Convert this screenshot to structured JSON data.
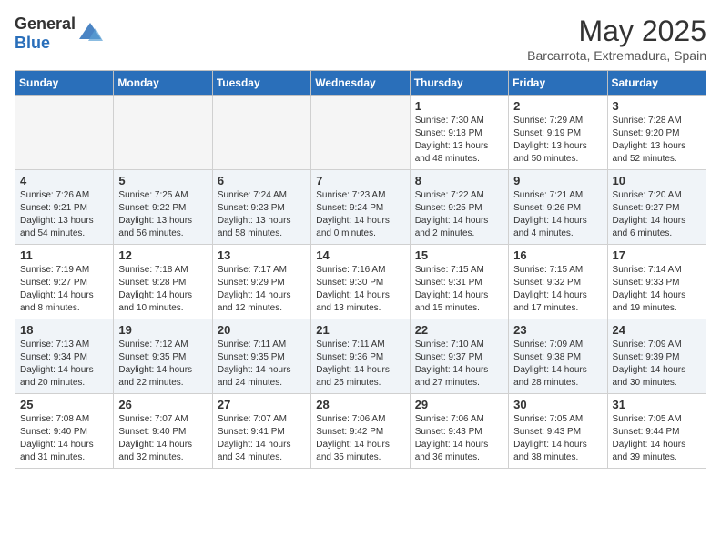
{
  "logo": {
    "text_general": "General",
    "text_blue": "Blue",
    "icon_alt": "GeneralBlue logo"
  },
  "title": {
    "month": "May 2025",
    "location": "Barcarrota, Extremadura, Spain"
  },
  "weekdays": [
    "Sunday",
    "Monday",
    "Tuesday",
    "Wednesday",
    "Thursday",
    "Friday",
    "Saturday"
  ],
  "weeks": [
    [
      {
        "day": "",
        "info": "",
        "empty": true
      },
      {
        "day": "",
        "info": "",
        "empty": true
      },
      {
        "day": "",
        "info": "",
        "empty": true
      },
      {
        "day": "",
        "info": "",
        "empty": true
      },
      {
        "day": "1",
        "info": "Sunrise: 7:30 AM\nSunset: 9:18 PM\nDaylight: 13 hours\nand 48 minutes."
      },
      {
        "day": "2",
        "info": "Sunrise: 7:29 AM\nSunset: 9:19 PM\nDaylight: 13 hours\nand 50 minutes."
      },
      {
        "day": "3",
        "info": "Sunrise: 7:28 AM\nSunset: 9:20 PM\nDaylight: 13 hours\nand 52 minutes."
      }
    ],
    [
      {
        "day": "4",
        "info": "Sunrise: 7:26 AM\nSunset: 9:21 PM\nDaylight: 13 hours\nand 54 minutes."
      },
      {
        "day": "5",
        "info": "Sunrise: 7:25 AM\nSunset: 9:22 PM\nDaylight: 13 hours\nand 56 minutes."
      },
      {
        "day": "6",
        "info": "Sunrise: 7:24 AM\nSunset: 9:23 PM\nDaylight: 13 hours\nand 58 minutes."
      },
      {
        "day": "7",
        "info": "Sunrise: 7:23 AM\nSunset: 9:24 PM\nDaylight: 14 hours\nand 0 minutes."
      },
      {
        "day": "8",
        "info": "Sunrise: 7:22 AM\nSunset: 9:25 PM\nDaylight: 14 hours\nand 2 minutes."
      },
      {
        "day": "9",
        "info": "Sunrise: 7:21 AM\nSunset: 9:26 PM\nDaylight: 14 hours\nand 4 minutes."
      },
      {
        "day": "10",
        "info": "Sunrise: 7:20 AM\nSunset: 9:27 PM\nDaylight: 14 hours\nand 6 minutes."
      }
    ],
    [
      {
        "day": "11",
        "info": "Sunrise: 7:19 AM\nSunset: 9:27 PM\nDaylight: 14 hours\nand 8 minutes."
      },
      {
        "day": "12",
        "info": "Sunrise: 7:18 AM\nSunset: 9:28 PM\nDaylight: 14 hours\nand 10 minutes."
      },
      {
        "day": "13",
        "info": "Sunrise: 7:17 AM\nSunset: 9:29 PM\nDaylight: 14 hours\nand 12 minutes."
      },
      {
        "day": "14",
        "info": "Sunrise: 7:16 AM\nSunset: 9:30 PM\nDaylight: 14 hours\nand 13 minutes."
      },
      {
        "day": "15",
        "info": "Sunrise: 7:15 AM\nSunset: 9:31 PM\nDaylight: 14 hours\nand 15 minutes."
      },
      {
        "day": "16",
        "info": "Sunrise: 7:15 AM\nSunset: 9:32 PM\nDaylight: 14 hours\nand 17 minutes."
      },
      {
        "day": "17",
        "info": "Sunrise: 7:14 AM\nSunset: 9:33 PM\nDaylight: 14 hours\nand 19 minutes."
      }
    ],
    [
      {
        "day": "18",
        "info": "Sunrise: 7:13 AM\nSunset: 9:34 PM\nDaylight: 14 hours\nand 20 minutes."
      },
      {
        "day": "19",
        "info": "Sunrise: 7:12 AM\nSunset: 9:35 PM\nDaylight: 14 hours\nand 22 minutes."
      },
      {
        "day": "20",
        "info": "Sunrise: 7:11 AM\nSunset: 9:35 PM\nDaylight: 14 hours\nand 24 minutes."
      },
      {
        "day": "21",
        "info": "Sunrise: 7:11 AM\nSunset: 9:36 PM\nDaylight: 14 hours\nand 25 minutes."
      },
      {
        "day": "22",
        "info": "Sunrise: 7:10 AM\nSunset: 9:37 PM\nDaylight: 14 hours\nand 27 minutes."
      },
      {
        "day": "23",
        "info": "Sunrise: 7:09 AM\nSunset: 9:38 PM\nDaylight: 14 hours\nand 28 minutes."
      },
      {
        "day": "24",
        "info": "Sunrise: 7:09 AM\nSunset: 9:39 PM\nDaylight: 14 hours\nand 30 minutes."
      }
    ],
    [
      {
        "day": "25",
        "info": "Sunrise: 7:08 AM\nSunset: 9:40 PM\nDaylight: 14 hours\nand 31 minutes."
      },
      {
        "day": "26",
        "info": "Sunrise: 7:07 AM\nSunset: 9:40 PM\nDaylight: 14 hours\nand 32 minutes."
      },
      {
        "day": "27",
        "info": "Sunrise: 7:07 AM\nSunset: 9:41 PM\nDaylight: 14 hours\nand 34 minutes."
      },
      {
        "day": "28",
        "info": "Sunrise: 7:06 AM\nSunset: 9:42 PM\nDaylight: 14 hours\nand 35 minutes."
      },
      {
        "day": "29",
        "info": "Sunrise: 7:06 AM\nSunset: 9:43 PM\nDaylight: 14 hours\nand 36 minutes."
      },
      {
        "day": "30",
        "info": "Sunrise: 7:05 AM\nSunset: 9:43 PM\nDaylight: 14 hours\nand 38 minutes."
      },
      {
        "day": "31",
        "info": "Sunrise: 7:05 AM\nSunset: 9:44 PM\nDaylight: 14 hours\nand 39 minutes."
      }
    ]
  ]
}
